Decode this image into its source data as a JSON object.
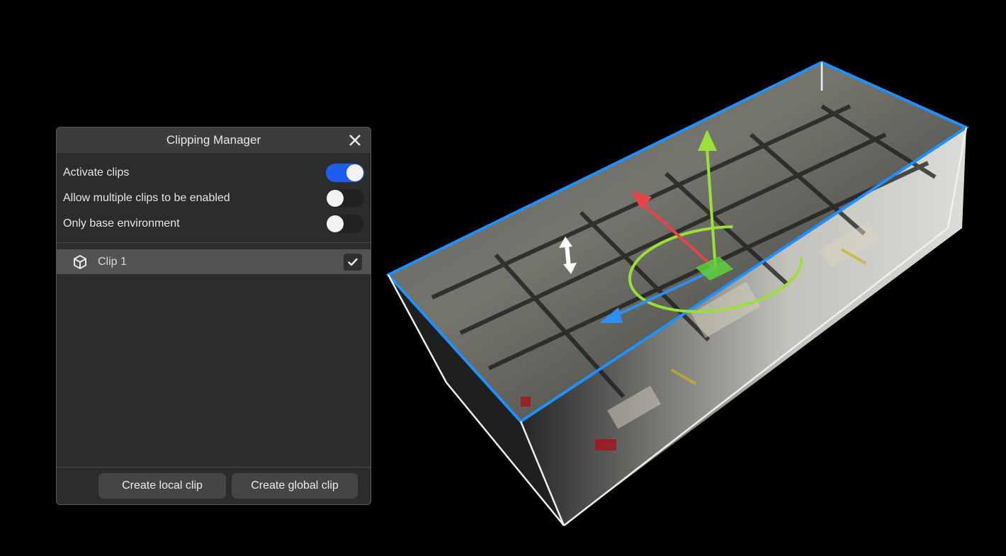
{
  "panel": {
    "title": "Clipping Manager",
    "toggles": [
      {
        "label": "Activate clips",
        "on": true
      },
      {
        "label": "Allow multiple clips to be enabled",
        "on": false
      },
      {
        "label": "Only base environment",
        "on": false
      }
    ],
    "clips": [
      {
        "label": "Clip 1",
        "checked": true,
        "icon": "cube-icon"
      }
    ],
    "buttons": {
      "create_local": "Create local clip",
      "create_global": "Create global clip"
    }
  },
  "scene": {
    "content": "clipped point cloud in clip box",
    "gizmo_axis_colors": {
      "x": "#e8424a",
      "y": "#9be03a",
      "z": "#2f8ff0"
    },
    "clip_box_top_edge_color": "#1e90ff",
    "accent": "#1f5cf0"
  }
}
